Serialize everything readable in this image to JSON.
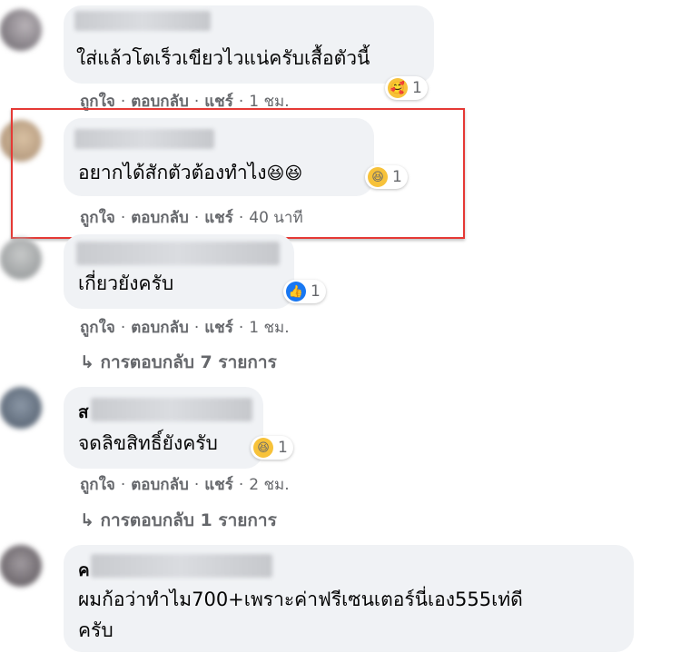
{
  "actions": {
    "like": "ถูกใจ",
    "reply": "ตอบกลับ",
    "share": "แชร์",
    "sep": "·"
  },
  "comments": [
    {
      "text": "ใส่แล้วโตเร็วเขียวไวแน่ครับเสื้อตัวนี้",
      "time": "1 ชม.",
      "reaction": "care",
      "reaction_count": "1"
    },
    {
      "text": "อยากได้สักตัวต้องทำไง",
      "inline_emoji": "😆😆",
      "time": "40 นาที",
      "reaction": "haha",
      "reaction_count": "1",
      "highlighted": true
    },
    {
      "text": "เกี่ยวยังครับ",
      "time": "1 ชม.",
      "reaction": "like",
      "reaction_count": "1",
      "replies": "การตอบกลับ 7 รายการ"
    },
    {
      "name_initial": "ส",
      "text": "จดลิขสิทธิ์ยังครับ",
      "time": "2 ชม.",
      "reaction": "haha",
      "reaction_count": "1",
      "replies": "การตอบกลับ 1 รายการ"
    },
    {
      "name_initial": "ค",
      "text_line1": "ผมก้อว่าทำไม700+เพราะค่าฟรีเซนเตอร์นี่เอง555เท่ดี",
      "text_line2": "ครับ"
    }
  ],
  "reply_arrow": "↳",
  "colors": {
    "highlight": "#e53935",
    "bubble": "#f0f2f5",
    "meta": "#65676b",
    "like": "#1877f2"
  }
}
